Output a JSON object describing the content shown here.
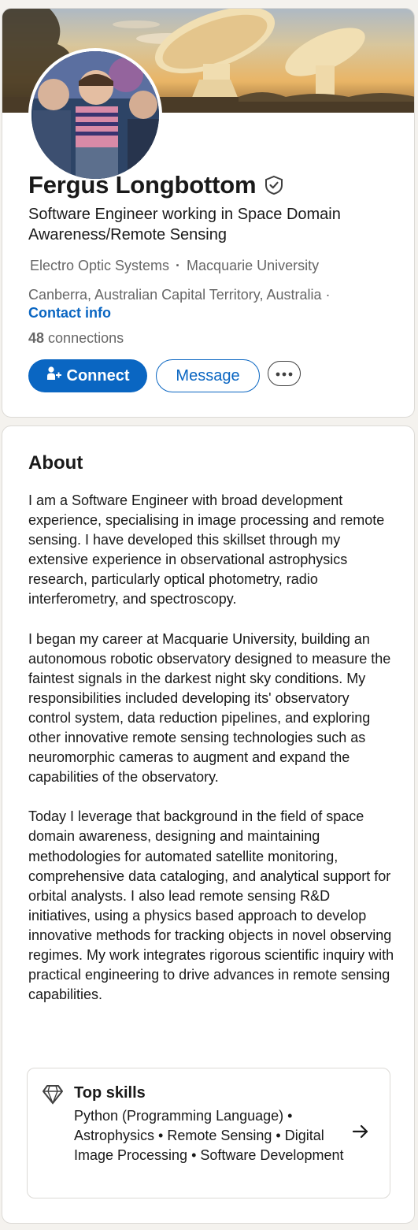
{
  "profile": {
    "name": "Fergus Longbottom",
    "headline": "Software Engineer working in Space Domain Awareness/Remote Sensing",
    "orgs": [
      "Electro Optic Systems",
      "Macquarie University"
    ],
    "location": "Canberra, Australian Capital Territory, Australia ·",
    "contact_label": "Contact info",
    "connections_count": "48",
    "connections_label": "connections",
    "icons": {
      "verified": "shield-check-icon",
      "connect": "person-add-icon",
      "more": "more-horizontal-icon"
    }
  },
  "actions": {
    "connect_label": "Connect",
    "message_label": "Message"
  },
  "about": {
    "title": "About",
    "paragraphs": [
      "I am a Software Engineer with broad development experience, specialising in image processing and remote sensing. I have developed this skillset through my extensive experience in observational astrophysics research, particularly optical photometry, radio interferometry, and spectroscopy.",
      "I began my career at Macquarie University, building an autonomous robotic observatory designed to measure the faintest signals in the darkest night sky conditions. My responsibilities included developing its' observatory control system, data reduction pipelines, and exploring other innovative remote sensing technologies such as neuromorphic cameras to augment and expand the capabilities of the observatory.",
      "Today I leverage that background in the field of space domain awareness, designing and maintaining methodologies for automated satellite monitoring, comprehensive data cataloging, and analytical support for orbital analysts. I also lead remote sensing R&D initiatives, using a physics based approach to develop innovative methods for tracking objects in novel observing regimes. My work integrates rigorous scientific inquiry with practical engineering to drive advances in remote sensing capabilities."
    ],
    "top_skills": {
      "title": "Top skills",
      "list": "Python (Programming Language) • Astrophysics • Remote Sensing • Digital Image Processing • Software Development"
    }
  },
  "colors": {
    "accent": "#0a66c2",
    "text": "#191919",
    "muted": "#666666",
    "background": "#f4f2ee"
  }
}
